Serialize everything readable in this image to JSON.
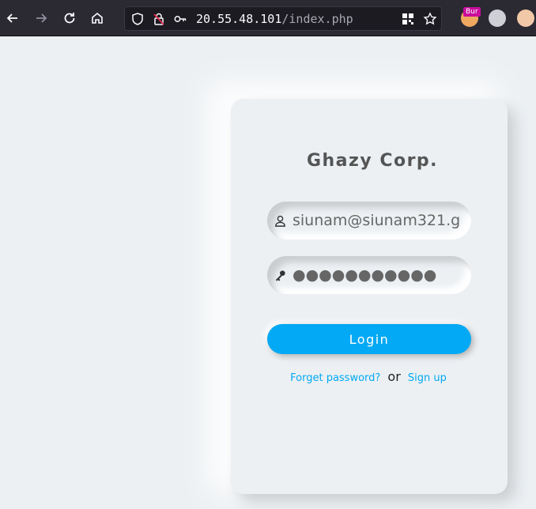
{
  "browser": {
    "url_host": "20.55.48.101",
    "url_path": "/index.php",
    "extension_badge": "Bur"
  },
  "login": {
    "brand": "Ghazy Corp.",
    "email_value": "siunam@siunam321.g",
    "password_mask": "●●●●●●●●●●●",
    "login_label": "Login",
    "forgot_label": "Forget password?",
    "or_label": "or",
    "signup_label": "Sign up"
  },
  "colors": {
    "accent": "#03a9f4",
    "background": "#ecf0f3",
    "toolbar": "#2b2a33"
  }
}
